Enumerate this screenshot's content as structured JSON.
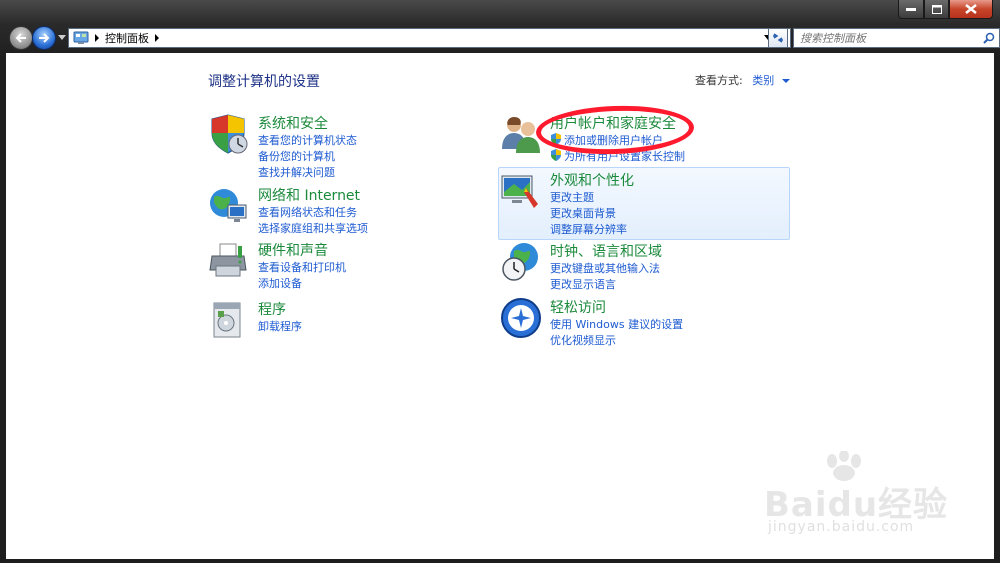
{
  "window": {
    "min_label": "",
    "max_label": "",
    "close_label": ""
  },
  "address": {
    "crumb": "控制面板"
  },
  "search": {
    "placeholder": "搜索控制面板"
  },
  "page": {
    "title": "调整计算机的设置",
    "viewby_label": "查看方式:",
    "viewby_value": "类别"
  },
  "categories": [
    {
      "title": "系统和安全",
      "links": [
        "查看您的计算机状态",
        "备份您的计算机",
        "查找并解决问题"
      ]
    },
    {
      "title": "网络和 Internet",
      "links": [
        "查看网络状态和任务",
        "选择家庭组和共享选项"
      ]
    },
    {
      "title": "硬件和声音",
      "links": [
        "查看设备和打印机",
        "添加设备"
      ]
    },
    {
      "title": "程序",
      "links": [
        "卸载程序"
      ]
    },
    {
      "title": "用户帐户和家庭安全",
      "links": [
        "添加或删除用户帐户",
        "为所有用户设置家长控制"
      ]
    },
    {
      "title": "外观和个性化",
      "links": [
        "更改主题",
        "更改桌面背景",
        "调整屏幕分辨率"
      ]
    },
    {
      "title": "时钟、语言和区域",
      "links": [
        "更改键盘或其他输入法",
        "更改显示语言"
      ]
    },
    {
      "title": "轻松访问",
      "links": [
        "使用 Windows 建议的设置",
        "优化视频显示"
      ]
    }
  ],
  "watermark": {
    "brand": "Baidu经验",
    "url": "jingyan.baidu.com"
  },
  "colors": {
    "category_title": "#1b8a3b",
    "link": "#1e5bd1",
    "annotation": "#ff1a2e",
    "hover_border": "#b8d6fb"
  }
}
